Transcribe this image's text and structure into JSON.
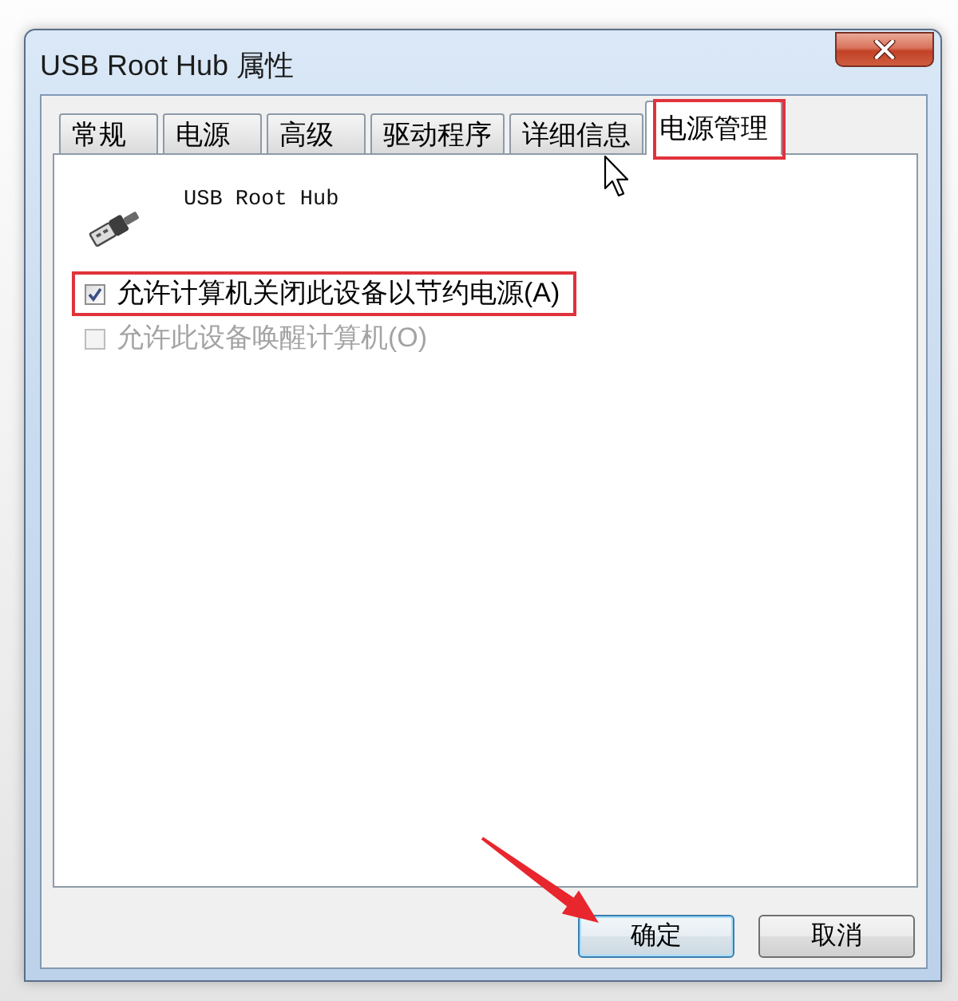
{
  "window": {
    "title": "USB Root Hub 属性"
  },
  "tabs": [
    {
      "label": "常规",
      "selected": false,
      "highlighted": false
    },
    {
      "label": "电源",
      "selected": false,
      "highlighted": false
    },
    {
      "label": "高级",
      "selected": false,
      "highlighted": false
    },
    {
      "label": "驱动程序",
      "selected": false,
      "highlighted": false
    },
    {
      "label": "详细信息",
      "selected": false,
      "highlighted": false
    },
    {
      "label": "电源管理",
      "selected": true,
      "highlighted": true
    }
  ],
  "device": {
    "name": "USB Root Hub"
  },
  "options": [
    {
      "label": "允许计算机关闭此设备以节约电源(A)",
      "checked": true,
      "disabled": false,
      "highlighted": true
    },
    {
      "label": "允许此设备唤醒计算机(O)",
      "checked": false,
      "disabled": true,
      "highlighted": false
    }
  ],
  "buttons": [
    {
      "label": "确定",
      "default": true,
      "arrow": true
    },
    {
      "label": "取消",
      "default": false,
      "arrow": false
    }
  ]
}
